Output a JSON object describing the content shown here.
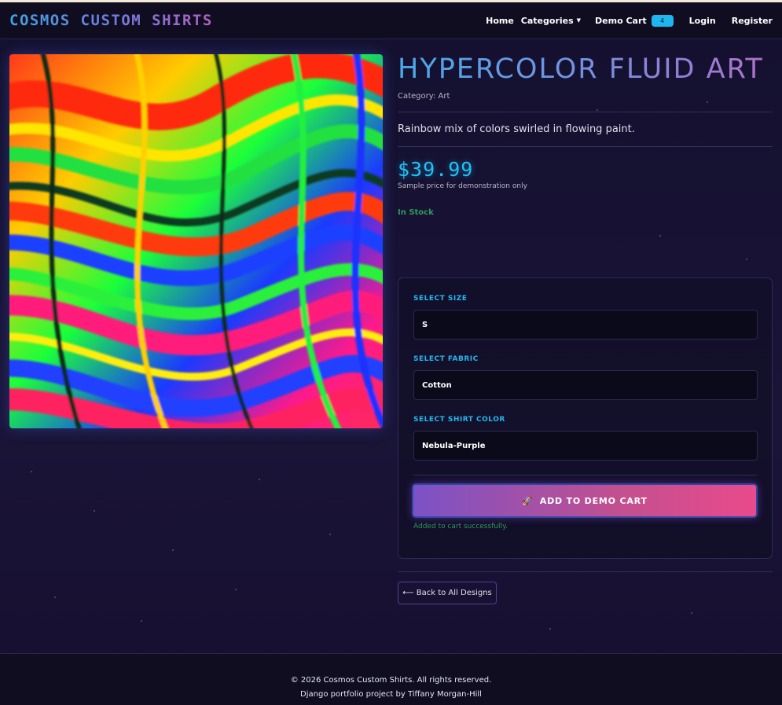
{
  "navbar": {
    "brand": "COSMOS CUSTOM SHIRTS",
    "home": "Home",
    "categories": "Categories",
    "demo_cart": "Demo Cart",
    "cart_count": "4",
    "login": "Login",
    "register": "Register"
  },
  "product": {
    "title": "HYPERCOLOR FLUID ART",
    "category": "Category: Art",
    "description": "Rainbow mix of colors swirled in flowing paint.",
    "price": "$39.99",
    "price_note": "Sample price for demonstration only",
    "stock": "In Stock"
  },
  "options": {
    "size_label": "SELECT SIZE",
    "size_value": "S",
    "fabric_label": "SELECT FABRIC",
    "fabric_value": "Cotton",
    "color_label": "SELECT SHIRT COLOR",
    "color_value": "Nebula-Purple",
    "add_button": "ADD TO DEMO CART",
    "success_message": "Added to cart successfully."
  },
  "back_button": "⟵ Back to All Designs",
  "footer": {
    "copyright": "© 2026 Cosmos Custom Shirts. All rights reserved.",
    "credit": "Django portfolio project by Tiffany Morgan-Hill"
  },
  "colors": {
    "accent_cyan": "#1fc0f4",
    "button_gradient_start": "#7b52c6",
    "button_gradient_end": "#e94a8b",
    "success_green": "#2f9a5a"
  },
  "icons": {
    "add_to_cart": "rocket-icon",
    "categories_dropdown": "caret-down-icon"
  }
}
